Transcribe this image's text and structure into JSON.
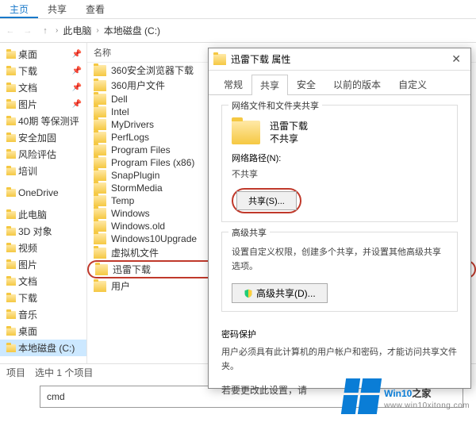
{
  "ribbon": {
    "tab_home": "主页",
    "tab_share": "共享",
    "tab_view": "查看"
  },
  "nav": {
    "pc": "此电脑",
    "drive": "本地磁盘 (C:)"
  },
  "tree": {
    "items": [
      {
        "label": "桌面"
      },
      {
        "label": "下载"
      },
      {
        "label": "文档"
      },
      {
        "label": "图片"
      },
      {
        "label": "40期 等保测评"
      },
      {
        "label": "安全加固"
      },
      {
        "label": "风险评估"
      },
      {
        "label": "培训"
      },
      {
        "label": ""
      },
      {
        "label": "OneDrive"
      },
      {
        "label": ""
      },
      {
        "label": "此电脑"
      },
      {
        "label": "3D 对象"
      },
      {
        "label": "视频"
      },
      {
        "label": "图片"
      },
      {
        "label": "文档"
      },
      {
        "label": "下载"
      },
      {
        "label": "音乐"
      },
      {
        "label": "桌面"
      },
      {
        "label": "本地磁盘 (C:)"
      }
    ]
  },
  "list": {
    "col_name": "名称",
    "items": [
      "360安全浏览器下载",
      "360用户文件",
      "Dell",
      "Intel",
      "MyDrivers",
      "PerfLogs",
      "Program Files",
      "Program Files (x86)",
      "SnapPlugin",
      "StormMedia",
      "Temp",
      "Windows",
      "Windows.old",
      "Windows10Upgrade",
      "虚拟机文件",
      "迅雷下载",
      "用户"
    ],
    "selected_index": 15
  },
  "status": {
    "item_count": "项目",
    "selected": "选中 1 个项目"
  },
  "cmd": {
    "value": "cmd"
  },
  "props": {
    "title": "迅雷下载 属性",
    "tabs": {
      "general": "常规",
      "sharing": "共享",
      "security": "安全",
      "prev": "以前的版本",
      "custom": "自定义"
    },
    "group_netshare": "网络文件和文件夹共享",
    "folder_name": "迅雷下载",
    "share_status": "不共享",
    "netpath_label": "网络路径(N):",
    "netpath_value": "不共享",
    "share_btn": "共享(S)...",
    "group_adv": "高级共享",
    "adv_text": "设置自定义权限，创建多个共享，并设置其他高级共享选项。",
    "adv_btn": "高级共享(D)...",
    "group_pwd": "密码保护",
    "pwd_text1": "用户必须具有此计算机的用户帐户和密码，才能访问共享文件夹。",
    "pwd_text2_prefix": "若要更改此设置，请"
  },
  "watermark": {
    "brand_a": "Win10",
    "brand_b": "之家",
    "url": "www.win10xitong.com"
  }
}
